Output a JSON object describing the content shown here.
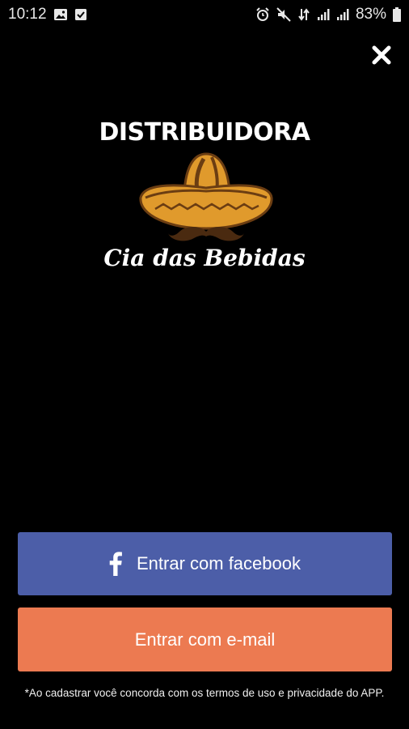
{
  "status_bar": {
    "time": "10:12",
    "battery": "83%",
    "icons_left": [
      "image-icon",
      "checkbox-icon"
    ],
    "icons_right": [
      "alarm-icon",
      "mute-icon",
      "data-icon",
      "signal-icon",
      "signal-icon",
      "battery-icon"
    ]
  },
  "logo": {
    "title": "DISTRIBUIDORA",
    "script": "Cia das Bebidas",
    "colors": {
      "hat": "#e09a2c",
      "hat_dark": "#6b3d12",
      "mustache": "#4a2a10"
    }
  },
  "buttons": {
    "facebook_label": "Entrar com facebook",
    "email_label": "Entrar com e-mail",
    "colors": {
      "facebook": "#4c5ea8",
      "email": "#ec7a51"
    }
  },
  "terms": "*Ao cadastrar você concorda com os termos de uso e privacidade do APP."
}
